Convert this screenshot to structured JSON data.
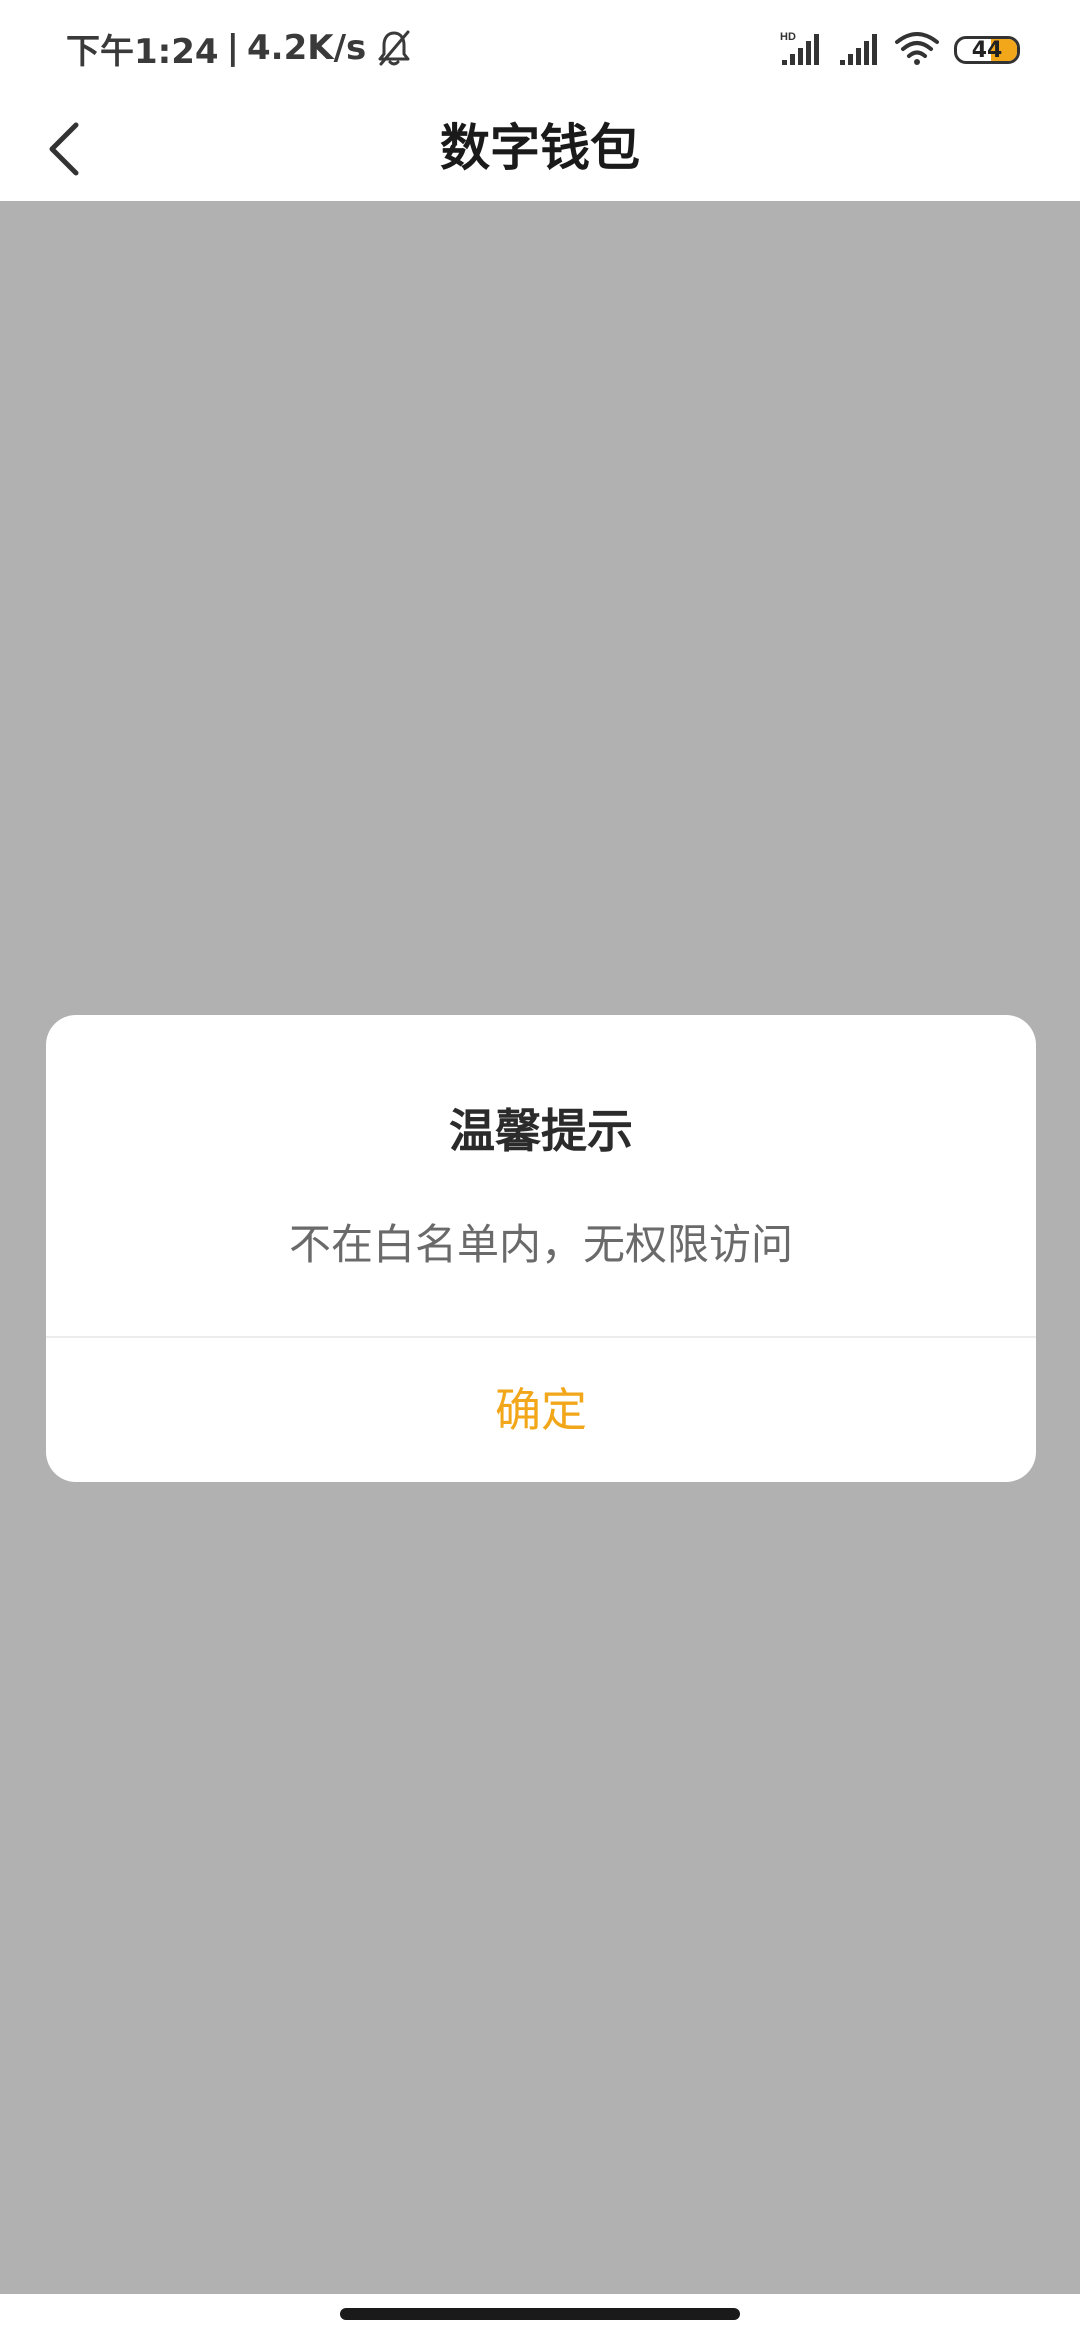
{
  "status_bar": {
    "time": "下午1:24",
    "separator": "|",
    "network_speed": "4.2K/s",
    "battery_level": "44",
    "battery_fraction": 0.44,
    "icons": [
      "mute-bell-icon",
      "hd-signal-icon",
      "signal-icon",
      "wifi-icon",
      "battery-icon"
    ]
  },
  "header": {
    "title": "数字钱包",
    "back_icon": "chevron-left-icon"
  },
  "dialog": {
    "title": "温馨提示",
    "message": "不在白名单内，无权限访问",
    "confirm_label": "确定"
  },
  "colors": {
    "accent": "#f2a71b",
    "overlay": "#b1b1b1",
    "surface": "#ffffff",
    "title_text": "#1a1a1a",
    "message_text": "#6a6a6a"
  }
}
